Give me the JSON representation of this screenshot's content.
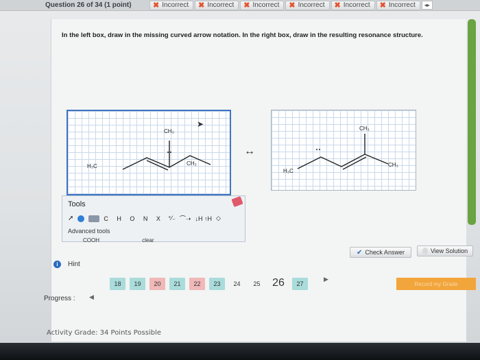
{
  "header": {
    "question_title": "Question 26 of 34 (1 point)",
    "status_tabs": [
      {
        "label": "Incorrect"
      },
      {
        "label": "Incorrect"
      },
      {
        "label": "Incorrect"
      },
      {
        "label": "Incorrect"
      },
      {
        "label": "Incorrect"
      },
      {
        "label": "Incorrect"
      }
    ],
    "nav_arrows": "◂▸"
  },
  "instructions": "In the left box, draw in the missing curved arrow notation. In the right box, draw in the resulting resonance structure.",
  "left_structure": {
    "top_label": "CH₃",
    "left_label": "H₃C",
    "right_label": "CH₃"
  },
  "resonance_arrow": "↔",
  "right_structure": {
    "top_label": "CH₃",
    "left_label": "H₃C",
    "right_label": "CH₃"
  },
  "tools": {
    "title": "Tools",
    "atom_buttons": "C H O N X",
    "charge_buttons": "↓H ↑H",
    "advanced_label": "Advanced tools",
    "bottom_row": "COOH",
    "clear_label": "clear"
  },
  "hint": {
    "icon": "i",
    "label": "Hint"
  },
  "buttons": {
    "check_answer": "Check Answer",
    "view_solution": "View Solution",
    "record_grade": "Record my Grade"
  },
  "progress": {
    "label": "Progress :",
    "pages": [
      {
        "n": "18",
        "state": "green"
      },
      {
        "n": "19",
        "state": "green"
      },
      {
        "n": "20",
        "state": "red"
      },
      {
        "n": "21",
        "state": "green"
      },
      {
        "n": "22",
        "state": "red"
      },
      {
        "n": "23",
        "state": "green"
      },
      {
        "n": "24",
        "state": "plain"
      },
      {
        "n": "25",
        "state": "plain"
      },
      {
        "n": "26",
        "state": "current"
      },
      {
        "n": "27",
        "state": "green"
      }
    ]
  },
  "activity_grade": "Activity Grade: 34 Points Possible",
  "colors": {
    "scrollbar": "#6aa341",
    "incorrect_x": "#e2532e",
    "record_button": "#f2a53b",
    "selected_box_border": "#3d73c2"
  }
}
